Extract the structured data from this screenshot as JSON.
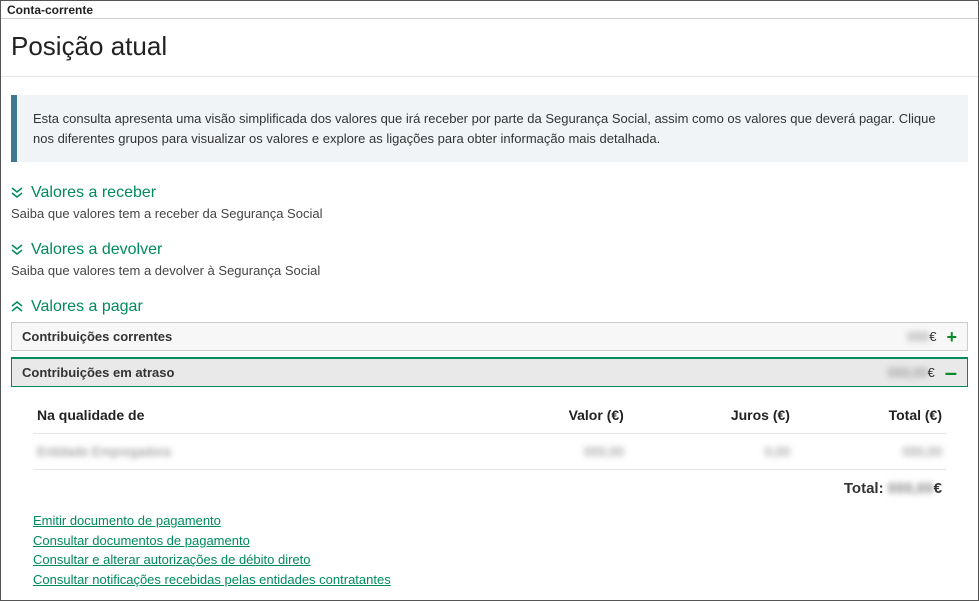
{
  "panel_header": "Conta-corrente",
  "page_title": "Posição atual",
  "info_text": "Esta consulta apresenta uma visão simplificada dos valores que irá receber por parte da Segurança Social, assim como os valores que deverá pagar. Clique nos diferentes grupos para visualizar os valores e explore as ligações para obter informação mais detalhada.",
  "sections": {
    "receber": {
      "title": "Valores a receber",
      "sub": "Saiba que valores tem a receber da Segurança Social"
    },
    "devolver": {
      "title": "Valores a devolver",
      "sub": "Saiba que valores tem a devolver à Segurança Social"
    },
    "pagar": {
      "title": "Valores a pagar"
    }
  },
  "accordion": {
    "correntes": {
      "label": "Contribuições correntes",
      "value_masked": "000",
      "euro": "€"
    },
    "atraso": {
      "label": "Contribuições em atraso",
      "value_masked": "000,00",
      "euro": "€"
    }
  },
  "table": {
    "headers": {
      "qual": "Na qualidade de",
      "valor": "Valor (€)",
      "juros": "Juros (€)",
      "total": "Total (€)"
    },
    "rows": [
      {
        "qual_masked": "Entidade Empregadora",
        "valor_masked": "000,00",
        "juros_masked": "0,00",
        "total_masked": "000,00"
      }
    ],
    "total_label": "Total:",
    "total_value_masked": "000,00",
    "total_euro": "€"
  },
  "links": {
    "l1": "Emitir documento de pagamento",
    "l2": "Consultar documentos de pagamento",
    "l3": "Consultar e alterar autorizações de débito direto",
    "l4": "Consultar notificações recebidas pelas entidades contratantes"
  }
}
